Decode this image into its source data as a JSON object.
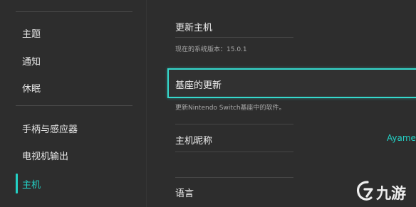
{
  "sidebar": {
    "items": [
      {
        "label": "主题"
      },
      {
        "label": "通知"
      },
      {
        "label": "休眠"
      },
      {
        "label": "手柄与感应器"
      },
      {
        "label": "电视机输出"
      },
      {
        "label": "主机"
      }
    ],
    "active_index": 5
  },
  "content": {
    "update_console": {
      "title": "更新主机",
      "desc": "现在的系统版本：15.0.1"
    },
    "dock_update": {
      "title": "基座的更新",
      "desc": "更新Nintendo Switch基座中的软件。"
    },
    "console_nickname": {
      "title": "主机昵称",
      "value": "Ayame"
    },
    "language": {
      "title": "语言"
    }
  },
  "watermark": {
    "text": "九游"
  },
  "colors": {
    "background": "#2d2d2d",
    "accent": "#23d2c6",
    "focus_border": "#35d9cd"
  }
}
